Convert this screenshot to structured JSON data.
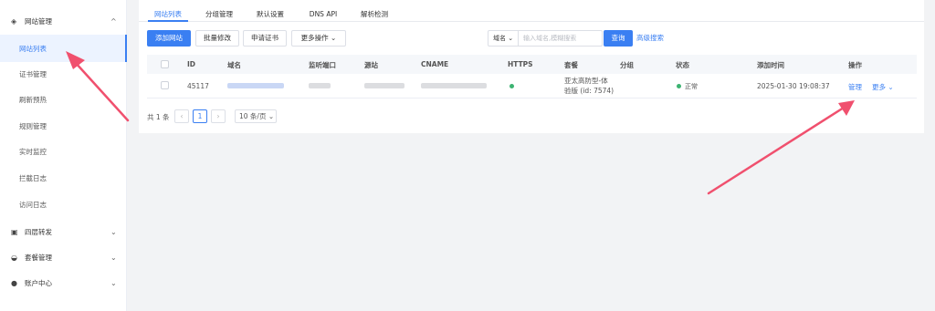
{
  "sidebar": {
    "groups": [
      {
        "label": "网站管理",
        "icon": "globe-icon",
        "chevron": "^"
      },
      {
        "label": "四层转发",
        "icon": "forward-icon",
        "chevron": "⌄"
      },
      {
        "label": "套餐管理",
        "icon": "basket-icon",
        "chevron": "⌄"
      },
      {
        "label": "账户中心",
        "icon": "user-icon",
        "chevron": "⌄"
      }
    ],
    "items": [
      {
        "label": "网站列表"
      },
      {
        "label": "证书管理"
      },
      {
        "label": "刷新预热"
      },
      {
        "label": "规则管理"
      },
      {
        "label": "实时监控"
      },
      {
        "label": "拦截日志"
      },
      {
        "label": "访问日志"
      }
    ]
  },
  "tabs": [
    {
      "label": "网站列表"
    },
    {
      "label": "分组管理"
    },
    {
      "label": "默认设置"
    },
    {
      "label": "DNS API"
    },
    {
      "label": "解析检测"
    }
  ],
  "toolbar": {
    "add_label": "添加网站",
    "batch_label": "批量修改",
    "cert_label": "申请证书",
    "more_label": "更多操作",
    "field_label": "域名",
    "search_placeholder": "输入域名,模糊搜索",
    "query_label": "查询",
    "advanced_label": "高级搜索"
  },
  "table": {
    "headers": {
      "id": "ID",
      "domain": "域名",
      "port": "监听端口",
      "origin": "源站",
      "cname": "CNAME",
      "https": "HTTPS",
      "plan": "套餐",
      "group": "分组",
      "status": "状态",
      "added": "添加时间",
      "actions": "操作"
    },
    "rows": [
      {
        "id": "45117",
        "plan_line1": "亚太高防型-体",
        "plan_line2": "验版 (id: 7574)",
        "status": "正常",
        "added": "2025-01-30 19:08:37",
        "manage": "管理",
        "more": "更多"
      }
    ]
  },
  "pagination": {
    "total": "共 1 条",
    "prev": "‹",
    "current": "1",
    "next": "›",
    "page_size": "10 条/页"
  },
  "colors": {
    "accent": "#3a7ff2",
    "annotation": "#f0506e",
    "status_ok": "#3cb371"
  }
}
